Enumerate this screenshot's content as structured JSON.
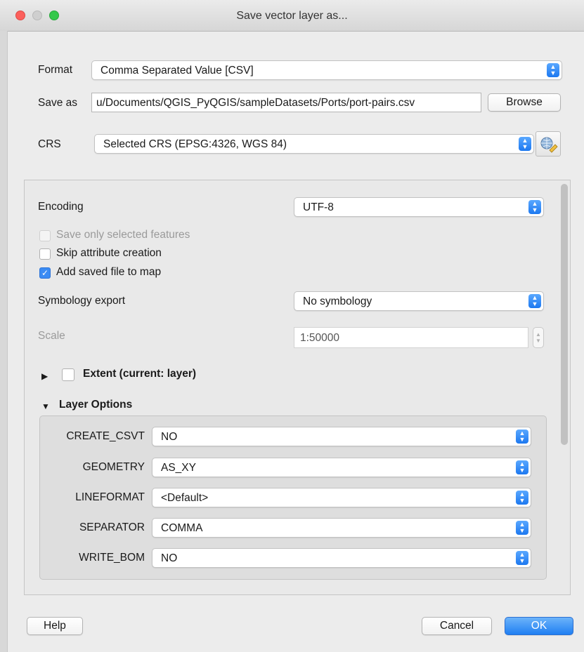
{
  "window": {
    "title": "Save vector layer as..."
  },
  "format": {
    "label": "Format",
    "value": "Comma Separated Value [CSV]"
  },
  "save_as": {
    "label": "Save as",
    "value": "u/Documents/QGIS_PyQGIS/sampleDatasets/Ports/port-pairs.csv",
    "browse_label": "Browse"
  },
  "crs": {
    "label": "CRS",
    "value": "Selected CRS (EPSG:4326, WGS 84)",
    "selector_icon": "globe-pencil-icon"
  },
  "encoding": {
    "label": "Encoding",
    "value": "UTF-8"
  },
  "options": {
    "selected_only": {
      "label": "Save only selected features",
      "checked": false,
      "enabled": false
    },
    "skip_attr": {
      "label": "Skip attribute creation",
      "checked": false
    },
    "add_to_map": {
      "label": "Add saved file to map",
      "checked": true
    }
  },
  "symbology": {
    "label": "Symbology export",
    "value": "No symbology"
  },
  "scale": {
    "label": "Scale",
    "value": "1:50000"
  },
  "extent": {
    "label": "Extent (current: layer)",
    "collapsed": true,
    "checked": false
  },
  "layer_options": {
    "title": "Layer Options",
    "rows": [
      {
        "key": "CREATE_CSVT",
        "value": "NO"
      },
      {
        "key": "GEOMETRY",
        "value": "AS_XY"
      },
      {
        "key": "LINEFORMAT",
        "value": "<Default>"
      },
      {
        "key": "SEPARATOR",
        "value": "COMMA"
      },
      {
        "key": "WRITE_BOM",
        "value": "NO"
      }
    ]
  },
  "buttons": {
    "help": "Help",
    "cancel": "Cancel",
    "ok": "OK"
  },
  "colors": {
    "accent": "#1f7ff2",
    "close": "#fc605c",
    "maximize": "#34c84a"
  }
}
